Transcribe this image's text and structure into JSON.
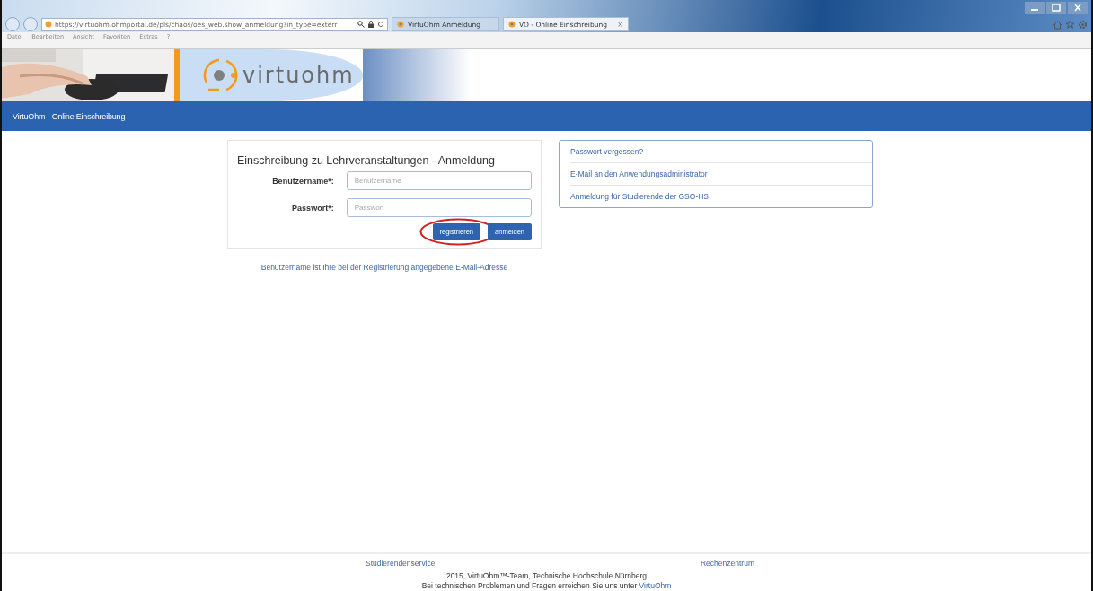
{
  "browser": {
    "url": "https://virtuohm.ohmportal.de/pls/chaos/oes_web.show_anmeldung?in_type=exterr",
    "tabs": [
      {
        "label": "VirtuOhm Anmeldung",
        "selected": false
      },
      {
        "label": "VO - Online Einschreibung",
        "selected": true,
        "close": "×"
      }
    ],
    "menu": [
      "Datei",
      "Bearbeiten",
      "Ansicht",
      "Favoriten",
      "Extras",
      "?"
    ]
  },
  "header": {
    "logo_text": "virtuohm",
    "kind": "picture"
  },
  "nav": {
    "title": "VirtuOhm - Online Einschreibung"
  },
  "login": {
    "title": "Einschreibung zu Lehrveranstaltungen - Anmeldung",
    "fields": [
      {
        "label": "Benutzername*:",
        "placeholder": "Benutzername"
      },
      {
        "label": "Passwort*:",
        "placeholder": "Passwort"
      }
    ],
    "buttons": [
      {
        "label": "registrieren",
        "circled": true
      },
      {
        "label": "anmelden",
        "circled": false
      }
    ],
    "hint": "Benutzername ist Ihre bei der Registrierung angegebene E-Mail-Adresse"
  },
  "links": [
    "Passwort vergessen?",
    "E-Mail an den Anwendungsadministrator",
    "Anmeldung für Studierende der GSO-HS"
  ],
  "footer": {
    "links": [
      "Studierendenservice",
      "Rechenzentrum"
    ],
    "copyright": "2015, VirtuOhm™-Team, Technische Hochschule Nürnberg",
    "contact": "Bei technischen Problemen und Fragen erreichen Sie uns unter",
    "contact_link": "VirtuOhm"
  }
}
